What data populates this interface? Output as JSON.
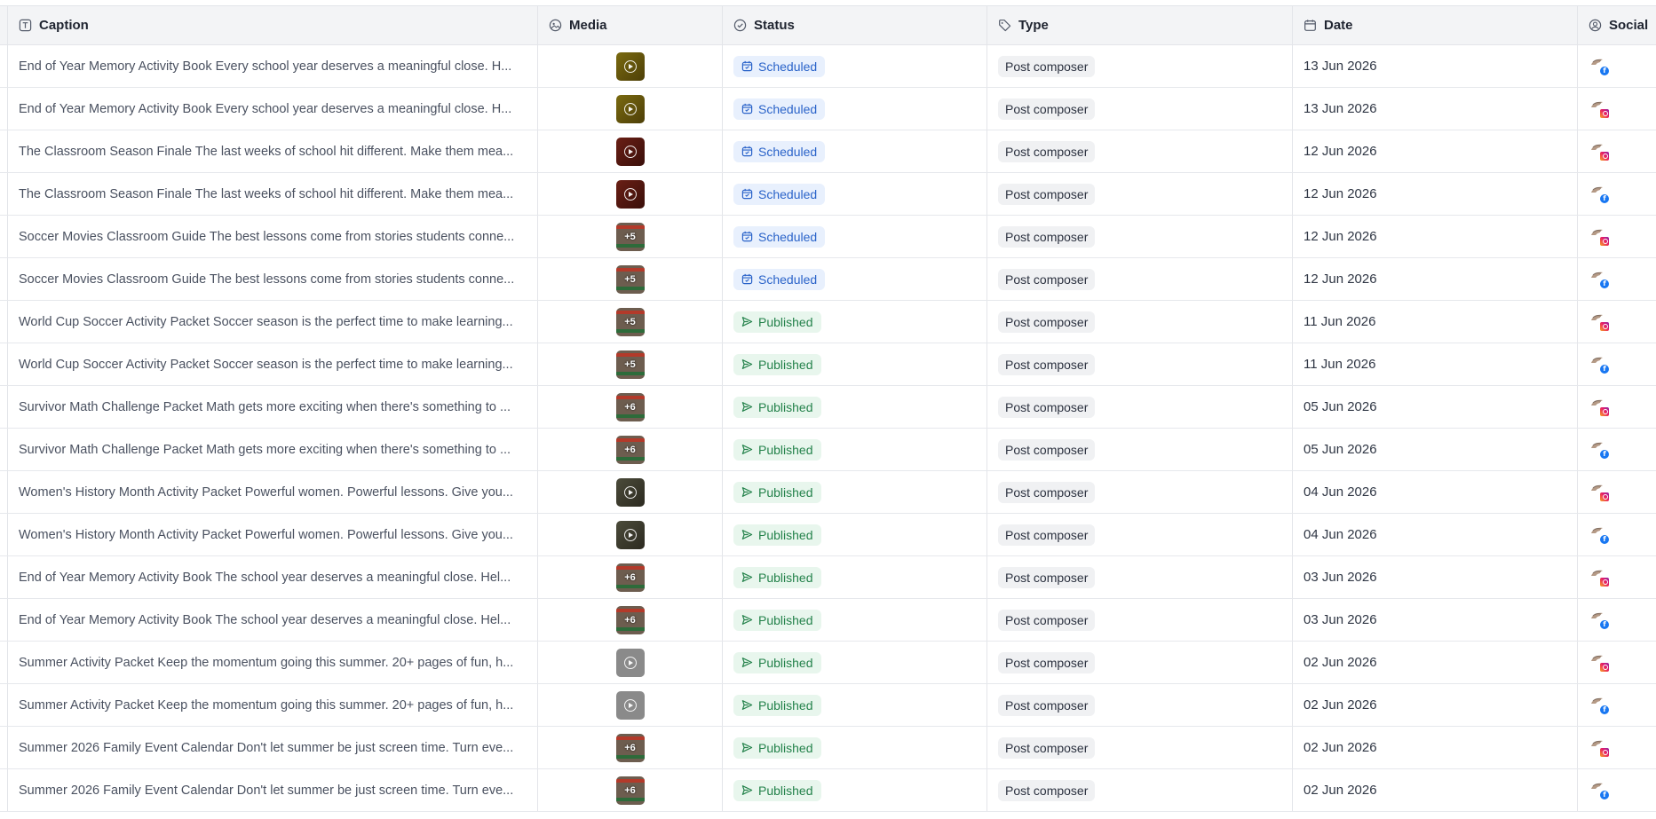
{
  "columns": {
    "caption": "Caption",
    "media": "Media",
    "status": "Status",
    "type": "Type",
    "date": "Date",
    "social": "Social"
  },
  "rows": [
    {
      "caption": "End of Year Memory Activity Book Every school year deserves a meaningful close. H...",
      "media": {
        "style": "olive",
        "overlay": "play"
      },
      "status": "Scheduled",
      "type": "Post composer",
      "date": "13 Jun 2026",
      "network": "facebook"
    },
    {
      "caption": "End of Year Memory Activity Book Every school year deserves a meaningful close. H...",
      "media": {
        "style": "olive",
        "overlay": "play"
      },
      "status": "Scheduled",
      "type": "Post composer",
      "date": "13 Jun 2026",
      "network": "instagram"
    },
    {
      "caption": "The Classroom Season Finale The last weeks of school hit different. Make them mea...",
      "media": {
        "style": "maroon",
        "overlay": "play"
      },
      "status": "Scheduled",
      "type": "Post composer",
      "date": "12 Jun 2026",
      "network": "instagram"
    },
    {
      "caption": "The Classroom Season Finale The last weeks of school hit different. Make them mea...",
      "media": {
        "style": "maroon",
        "overlay": "play"
      },
      "status": "Scheduled",
      "type": "Post composer",
      "date": "12 Jun 2026",
      "network": "facebook"
    },
    {
      "caption": "Soccer Movies Classroom Guide The best lessons come from stories students conne...",
      "media": {
        "style": "soccer",
        "overlay": "+5"
      },
      "status": "Scheduled",
      "type": "Post composer",
      "date": "12 Jun 2026",
      "network": "instagram"
    },
    {
      "caption": "Soccer Movies Classroom Guide The best lessons come from stories students conne...",
      "media": {
        "style": "soccer",
        "overlay": "+5"
      },
      "status": "Scheduled",
      "type": "Post composer",
      "date": "12 Jun 2026",
      "network": "facebook"
    },
    {
      "caption": "World Cup Soccer Activity Packet Soccer season is the perfect time to make learning...",
      "media": {
        "style": "soccer",
        "overlay": "+5"
      },
      "status": "Published",
      "type": "Post composer",
      "date": "11 Jun 2026",
      "network": "instagram"
    },
    {
      "caption": "World Cup Soccer Activity Packet Soccer season is the perfect time to make learning...",
      "media": {
        "style": "soccer",
        "overlay": "+5"
      },
      "status": "Published",
      "type": "Post composer",
      "date": "11 Jun 2026",
      "network": "facebook"
    },
    {
      "caption": "Survivor Math Challenge Packet Math gets more exciting when there's something to ...",
      "media": {
        "style": "soccer",
        "overlay": "+6"
      },
      "status": "Published",
      "type": "Post composer",
      "date": "05 Jun 2026",
      "network": "instagram"
    },
    {
      "caption": "Survivor Math Challenge Packet Math gets more exciting when there's something to ...",
      "media": {
        "style": "soccer",
        "overlay": "+6"
      },
      "status": "Published",
      "type": "Post composer",
      "date": "05 Jun 2026",
      "network": "facebook"
    },
    {
      "caption": "Women's History Month Activity Packet Powerful women. Powerful lessons. Give you...",
      "media": {
        "style": "women",
        "overlay": "play"
      },
      "status": "Published",
      "type": "Post composer",
      "date": "04 Jun 2026",
      "network": "instagram"
    },
    {
      "caption": "Women's History Month Activity Packet Powerful women. Powerful lessons. Give you...",
      "media": {
        "style": "women",
        "overlay": "play"
      },
      "status": "Published",
      "type": "Post composer",
      "date": "04 Jun 2026",
      "network": "facebook"
    },
    {
      "caption": "End of Year Memory Activity Book The school year deserves a meaningful close. Hel...",
      "media": {
        "style": "soccer",
        "overlay": "+6"
      },
      "status": "Published",
      "type": "Post composer",
      "date": "03 Jun 2026",
      "network": "instagram"
    },
    {
      "caption": "End of Year Memory Activity Book The school year deserves a meaningful close. Hel...",
      "media": {
        "style": "soccer",
        "overlay": "+6"
      },
      "status": "Published",
      "type": "Post composer",
      "date": "03 Jun 2026",
      "network": "facebook"
    },
    {
      "caption": "Summer Activity Packet Keep the momentum going this summer. 20+ pages of fun, h...",
      "media": {
        "style": "grey",
        "overlay": "play"
      },
      "status": "Published",
      "type": "Post composer",
      "date": "02 Jun 2026",
      "network": "instagram"
    },
    {
      "caption": "Summer Activity Packet Keep the momentum going this summer. 20+ pages of fun, h...",
      "media": {
        "style": "grey",
        "overlay": "play"
      },
      "status": "Published",
      "type": "Post composer",
      "date": "02 Jun 2026",
      "network": "facebook"
    },
    {
      "caption": "Summer 2026 Family Event Calendar Don't let summer be just screen time. Turn eve...",
      "media": {
        "style": "soccer",
        "overlay": "+6"
      },
      "status": "Published",
      "type": "Post composer",
      "date": "02 Jun 2026",
      "network": "instagram"
    },
    {
      "caption": "Summer 2026 Family Event Calendar Don't let summer be just screen time. Turn eve...",
      "media": {
        "style": "soccer",
        "overlay": "+6"
      },
      "status": "Published",
      "type": "Post composer",
      "date": "02 Jun 2026",
      "network": "facebook"
    }
  ],
  "colors": {
    "scheduled": "#2a63c9",
    "published": "#24824b",
    "facebook": "#1877f2",
    "instagram": "#e91e63"
  }
}
